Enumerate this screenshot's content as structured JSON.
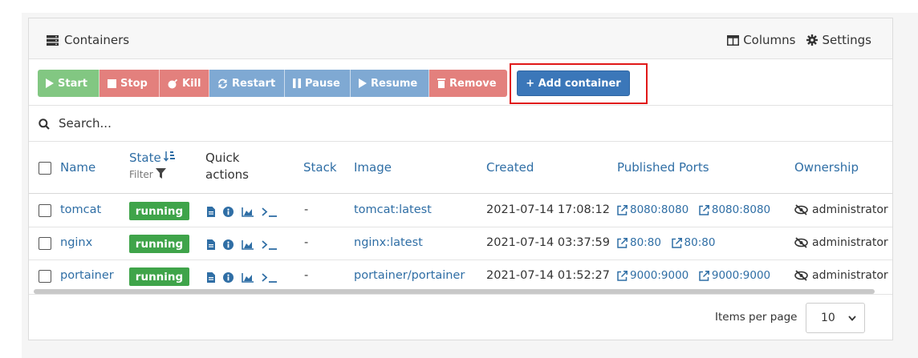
{
  "header": {
    "title": "Containers",
    "columns_label": "Columns",
    "settings_label": "Settings"
  },
  "toolbar": {
    "start_label": "Start",
    "stop_label": "Stop",
    "kill_label": "Kill",
    "restart_label": "Restart",
    "pause_label": "Pause",
    "resume_label": "Resume",
    "remove_label": "Remove",
    "add_container_label": "+ Add container"
  },
  "search": {
    "placeholder": "Search..."
  },
  "table": {
    "columns": {
      "name": "Name",
      "state": "State",
      "state_filter": "Filter",
      "quick_actions_line1": "Quick",
      "quick_actions_line2": "actions",
      "stack": "Stack",
      "image": "Image",
      "created": "Created",
      "published_ports": "Published Ports",
      "ownership": "Ownership"
    },
    "rows": [
      {
        "name": "tomcat",
        "state": "running",
        "stack": "-",
        "image": "tomcat:latest",
        "created": "2021-07-14 17:08:12",
        "port1": "8080:8080",
        "port2": "8080:8080",
        "ownership": "administrator"
      },
      {
        "name": "nginx",
        "state": "running",
        "stack": "-",
        "image": "nginx:latest",
        "created": "2021-07-14 03:37:59",
        "port1": "80:80",
        "port2": "80:80",
        "ownership": "administrator"
      },
      {
        "name": "portainer",
        "state": "running",
        "stack": "-",
        "image": "portainer/portainer",
        "created": "2021-07-14 01:52:27",
        "port1": "9000:9000",
        "port2": "9000:9000",
        "ownership": "administrator"
      }
    ]
  },
  "footer": {
    "items_per_page_label": "Items per page",
    "items_per_page_value": "10"
  },
  "colors": {
    "start": "#82c782",
    "danger": "#e3807d",
    "info": "#7fa9d3",
    "primary": "#3b77b9",
    "running": "#3fa44a",
    "link": "#2f6ea5",
    "highlight": "#e01818"
  },
  "icons": {
    "title": "server-icon",
    "columns": "columns-icon",
    "settings": "gear-icon",
    "search": "search-icon"
  }
}
